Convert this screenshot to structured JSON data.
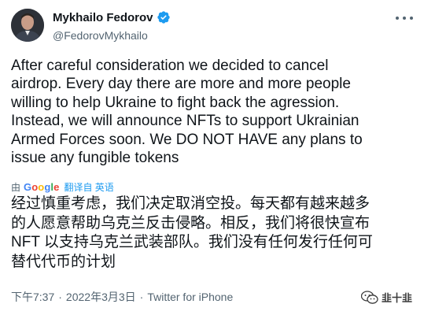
{
  "tweet": {
    "author_name": "Mykhailo Fedorov",
    "handle": "@FedorovMykhailo",
    "text": "After careful consideration we decided to cancel\nairdrop. Every day there are more and more people\nwilling to help Ukraine to fight back the agression.\nInstead, we will announce NFTs to support Ukrainian\nArmed Forces soon. We DO NOT HAVE any plans to\nissue any fungible tokens",
    "translated_by_prefix": "由",
    "translate_label": "翻译自 英语",
    "translated_text": "经过慎重考虑，我们决定取消空投。每天都有越来越多\n的人愿意帮助乌克兰反击侵略。相反，我们将很快宣布\nNFT 以支持乌克兰武装部队。我们没有任何发行任何可\n替代代币的计划",
    "time": "下午7:37",
    "separator": "·",
    "date": "2022年3月3日",
    "source": "Twitter for iPhone"
  },
  "google_logo": [
    "G",
    "o",
    "o",
    "g",
    "l",
    "e"
  ],
  "watermark_text": "韭十韭",
  "colors": {
    "verified": "#1d9bf0",
    "link": "#1d9bf0",
    "muted": "#536471"
  }
}
